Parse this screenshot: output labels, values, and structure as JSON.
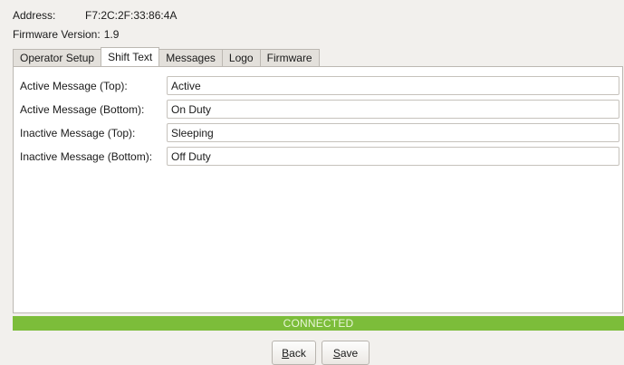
{
  "device": {
    "address_label": "Address:",
    "address_value": "F7:2C:2F:33:86:4A",
    "firmware_label": "Firmware Version:",
    "firmware_value": "1.9"
  },
  "tabs": [
    {
      "label": "Operator Setup",
      "active": false
    },
    {
      "label": "Shift Text",
      "active": true
    },
    {
      "label": "Messages",
      "active": false
    },
    {
      "label": "Logo",
      "active": false
    },
    {
      "label": "Firmware",
      "active": false
    }
  ],
  "shift_text": {
    "fields": [
      {
        "label": "Active Message (Top):",
        "value": "Active"
      },
      {
        "label": "Active Message (Bottom):",
        "value": "On Duty"
      },
      {
        "label": "Inactive Message (Top):",
        "value": "Sleeping"
      },
      {
        "label": "Inactive Message (Bottom):",
        "value": "Off Duty"
      }
    ]
  },
  "status": {
    "text": "CONNECTED",
    "color": "#7cbd3a"
  },
  "buttons": {
    "back_mnemonic": "B",
    "back_rest": "ack",
    "save_mnemonic": "S",
    "save_rest": "ave"
  }
}
